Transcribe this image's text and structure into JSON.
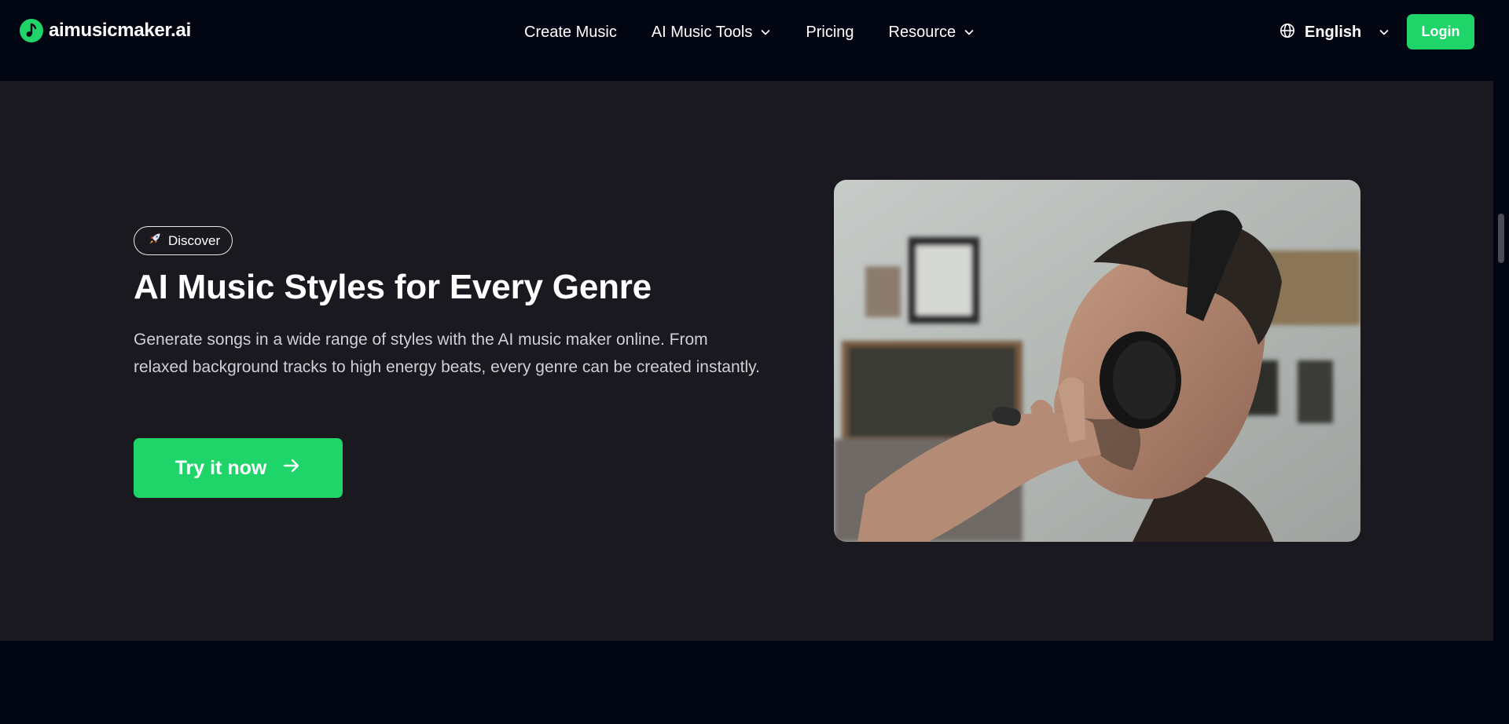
{
  "header": {
    "logo_text": "aimusicmaker.ai",
    "nav": [
      {
        "label": "Create Music",
        "has_dropdown": false
      },
      {
        "label": "AI Music Tools",
        "has_dropdown": true
      },
      {
        "label": "Pricing",
        "has_dropdown": false
      },
      {
        "label": "Resource",
        "has_dropdown": true
      }
    ],
    "language": "English",
    "login_label": "Login"
  },
  "hero": {
    "badge_label": "Discover",
    "title": "AI Music Styles for Every Genre",
    "description": "Generate songs in a wide range of styles with the AI music maker online. From relaxed background tracks to high energy beats, every genre can be created instantly.",
    "cta_label": "Try it now",
    "image_alt": "Man wearing headphones"
  },
  "colors": {
    "accent": "#1fd469",
    "header_bg": "#020512",
    "hero_bg": "#1a191f"
  },
  "icons": [
    "music-note-icon",
    "chevron-down-icon",
    "globe-icon",
    "rocket-icon",
    "arrow-right-icon"
  ]
}
